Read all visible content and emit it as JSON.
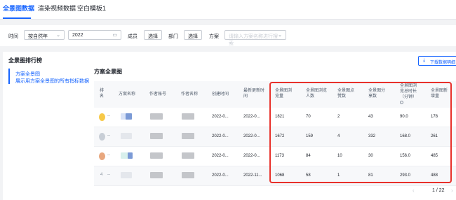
{
  "tabs": [
    {
      "label": "全景图数据",
      "active": true
    },
    {
      "label": "渲染视频数据",
      "active": false
    },
    {
      "label": "空白模板1",
      "active": false
    }
  ],
  "filters": {
    "time_label": "时间",
    "time_mode": "按自然年",
    "year": "2022",
    "member_label": "成员",
    "member_button": "选择",
    "dept_label": "部门",
    "dept_button": "选择",
    "scheme_label": "方案",
    "scheme_placeholder": "请输入方案名称进行搜索"
  },
  "left_panel": {
    "title": "全景图排行榜",
    "items": [
      "方案全景图",
      "展示用方案全景图的所有指标数据"
    ]
  },
  "right_panel": {
    "title": "方案全景图",
    "download_label": "下载数据明细"
  },
  "table": {
    "headers": [
      "排名",
      "方案名称",
      "作者账号",
      "作者名称",
      "创建时间",
      "最新更新时间",
      "全景图浏览量",
      "全景图浏览人数",
      "全景图点赞数",
      "全景图分享数",
      "全景图浏览总时长（分钟）",
      "全景图新增量"
    ],
    "rows": [
      {
        "rank": "",
        "medal": "gold",
        "created": "2022-0...",
        "updated": "2022-0...",
        "views": "1821",
        "visitors": "70",
        "likes": "2",
        "shares": "43",
        "duration": "90.0",
        "new": "178"
      },
      {
        "rank": "",
        "medal": "silver",
        "created": "2022-0...",
        "updated": "2022-0...",
        "views": "1672",
        "visitors": "159",
        "likes": "4",
        "shares": "332",
        "duration": "168.0",
        "new": "261"
      },
      {
        "rank": "",
        "medal": "bronze",
        "created": "2022-0...",
        "updated": "2022-0...",
        "views": "1173",
        "visitors": "84",
        "likes": "10",
        "shares": "30",
        "duration": "156.0",
        "new": "485"
      },
      {
        "rank": "4",
        "medal": "",
        "created": "2022-0...",
        "updated": "2022-11...",
        "views": "1068",
        "visitors": "58",
        "likes": "1",
        "shares": "81",
        "duration": "293.0",
        "new": "488"
      }
    ],
    "dash": "--"
  },
  "pagination": {
    "text": "1 / 22"
  },
  "colors": {
    "accent": "#1664ff",
    "highlight_box": "#e8312b",
    "gold": "#f7c948",
    "silver": "#c8ced6",
    "bronze": "#e8a77e"
  }
}
